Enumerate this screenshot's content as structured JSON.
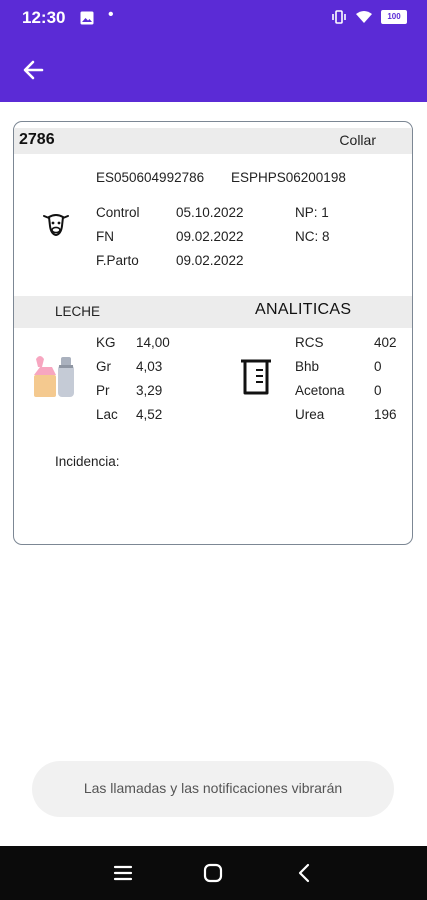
{
  "status_bar": {
    "time": "12:30",
    "battery": "100"
  },
  "card": {
    "animal_id": "2786",
    "collar_label": "Collar",
    "codes": [
      "ES050604992786",
      "ESPHPS06200198"
    ],
    "info": {
      "control_label": "Control",
      "control_value": "05.10.2022",
      "fn_label": "FN",
      "fn_value": "09.02.2022",
      "fparto_label": "F.Parto",
      "fparto_value": "09.02.2022",
      "np": "NP: 1",
      "nc": "NC: 8"
    },
    "leche": {
      "title": "LECHE",
      "rows": [
        {
          "label": "KG",
          "value": "14,00"
        },
        {
          "label": "Gr",
          "value": "4,03"
        },
        {
          "label": "Pr",
          "value": "3,29"
        },
        {
          "label": "Lac",
          "value": "4,52"
        }
      ]
    },
    "analiticas": {
      "title": "ANALITICAS",
      "rows": [
        {
          "label": "RCS",
          "value": "402"
        },
        {
          "label": "Bhb",
          "value": "0"
        },
        {
          "label": "Acetona",
          "value": "0"
        },
        {
          "label": "Urea",
          "value": "196"
        }
      ]
    },
    "incidencia_label": "Incidencia:"
  },
  "toast": {
    "text": "Las llamadas y las notificaciones vibrarán"
  }
}
